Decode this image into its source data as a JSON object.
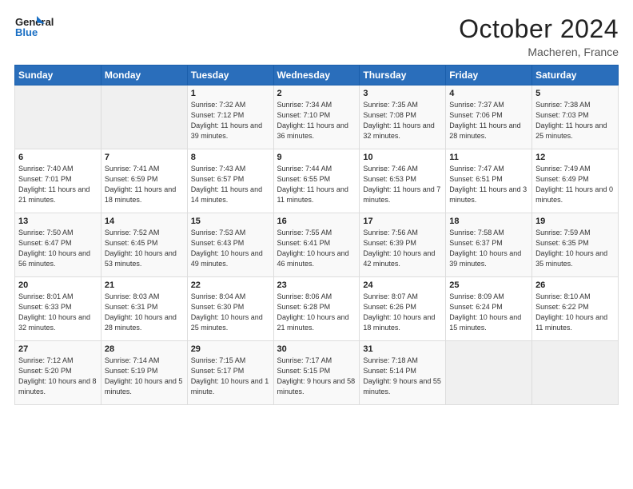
{
  "logo": {
    "line1": "General",
    "line2": "Blue"
  },
  "title": "October 2024",
  "location": "Macheren, France",
  "days_of_week": [
    "Sunday",
    "Monday",
    "Tuesday",
    "Wednesday",
    "Thursday",
    "Friday",
    "Saturday"
  ],
  "weeks": [
    [
      {
        "day": "",
        "info": ""
      },
      {
        "day": "",
        "info": ""
      },
      {
        "day": "1",
        "info": "Sunrise: 7:32 AM\nSunset: 7:12 PM\nDaylight: 11 hours and 39 minutes."
      },
      {
        "day": "2",
        "info": "Sunrise: 7:34 AM\nSunset: 7:10 PM\nDaylight: 11 hours and 36 minutes."
      },
      {
        "day": "3",
        "info": "Sunrise: 7:35 AM\nSunset: 7:08 PM\nDaylight: 11 hours and 32 minutes."
      },
      {
        "day": "4",
        "info": "Sunrise: 7:37 AM\nSunset: 7:06 PM\nDaylight: 11 hours and 28 minutes."
      },
      {
        "day": "5",
        "info": "Sunrise: 7:38 AM\nSunset: 7:03 PM\nDaylight: 11 hours and 25 minutes."
      }
    ],
    [
      {
        "day": "6",
        "info": "Sunrise: 7:40 AM\nSunset: 7:01 PM\nDaylight: 11 hours and 21 minutes."
      },
      {
        "day": "7",
        "info": "Sunrise: 7:41 AM\nSunset: 6:59 PM\nDaylight: 11 hours and 18 minutes."
      },
      {
        "day": "8",
        "info": "Sunrise: 7:43 AM\nSunset: 6:57 PM\nDaylight: 11 hours and 14 minutes."
      },
      {
        "day": "9",
        "info": "Sunrise: 7:44 AM\nSunset: 6:55 PM\nDaylight: 11 hours and 11 minutes."
      },
      {
        "day": "10",
        "info": "Sunrise: 7:46 AM\nSunset: 6:53 PM\nDaylight: 11 hours and 7 minutes."
      },
      {
        "day": "11",
        "info": "Sunrise: 7:47 AM\nSunset: 6:51 PM\nDaylight: 11 hours and 3 minutes."
      },
      {
        "day": "12",
        "info": "Sunrise: 7:49 AM\nSunset: 6:49 PM\nDaylight: 11 hours and 0 minutes."
      }
    ],
    [
      {
        "day": "13",
        "info": "Sunrise: 7:50 AM\nSunset: 6:47 PM\nDaylight: 10 hours and 56 minutes."
      },
      {
        "day": "14",
        "info": "Sunrise: 7:52 AM\nSunset: 6:45 PM\nDaylight: 10 hours and 53 minutes."
      },
      {
        "day": "15",
        "info": "Sunrise: 7:53 AM\nSunset: 6:43 PM\nDaylight: 10 hours and 49 minutes."
      },
      {
        "day": "16",
        "info": "Sunrise: 7:55 AM\nSunset: 6:41 PM\nDaylight: 10 hours and 46 minutes."
      },
      {
        "day": "17",
        "info": "Sunrise: 7:56 AM\nSunset: 6:39 PM\nDaylight: 10 hours and 42 minutes."
      },
      {
        "day": "18",
        "info": "Sunrise: 7:58 AM\nSunset: 6:37 PM\nDaylight: 10 hours and 39 minutes."
      },
      {
        "day": "19",
        "info": "Sunrise: 7:59 AM\nSunset: 6:35 PM\nDaylight: 10 hours and 35 minutes."
      }
    ],
    [
      {
        "day": "20",
        "info": "Sunrise: 8:01 AM\nSunset: 6:33 PM\nDaylight: 10 hours and 32 minutes."
      },
      {
        "day": "21",
        "info": "Sunrise: 8:03 AM\nSunset: 6:31 PM\nDaylight: 10 hours and 28 minutes."
      },
      {
        "day": "22",
        "info": "Sunrise: 8:04 AM\nSunset: 6:30 PM\nDaylight: 10 hours and 25 minutes."
      },
      {
        "day": "23",
        "info": "Sunrise: 8:06 AM\nSunset: 6:28 PM\nDaylight: 10 hours and 21 minutes."
      },
      {
        "day": "24",
        "info": "Sunrise: 8:07 AM\nSunset: 6:26 PM\nDaylight: 10 hours and 18 minutes."
      },
      {
        "day": "25",
        "info": "Sunrise: 8:09 AM\nSunset: 6:24 PM\nDaylight: 10 hours and 15 minutes."
      },
      {
        "day": "26",
        "info": "Sunrise: 8:10 AM\nSunset: 6:22 PM\nDaylight: 10 hours and 11 minutes."
      }
    ],
    [
      {
        "day": "27",
        "info": "Sunrise: 7:12 AM\nSunset: 5:20 PM\nDaylight: 10 hours and 8 minutes."
      },
      {
        "day": "28",
        "info": "Sunrise: 7:14 AM\nSunset: 5:19 PM\nDaylight: 10 hours and 5 minutes."
      },
      {
        "day": "29",
        "info": "Sunrise: 7:15 AM\nSunset: 5:17 PM\nDaylight: 10 hours and 1 minute."
      },
      {
        "day": "30",
        "info": "Sunrise: 7:17 AM\nSunset: 5:15 PM\nDaylight: 9 hours and 58 minutes."
      },
      {
        "day": "31",
        "info": "Sunrise: 7:18 AM\nSunset: 5:14 PM\nDaylight: 9 hours and 55 minutes."
      },
      {
        "day": "",
        "info": ""
      },
      {
        "day": "",
        "info": ""
      }
    ]
  ]
}
